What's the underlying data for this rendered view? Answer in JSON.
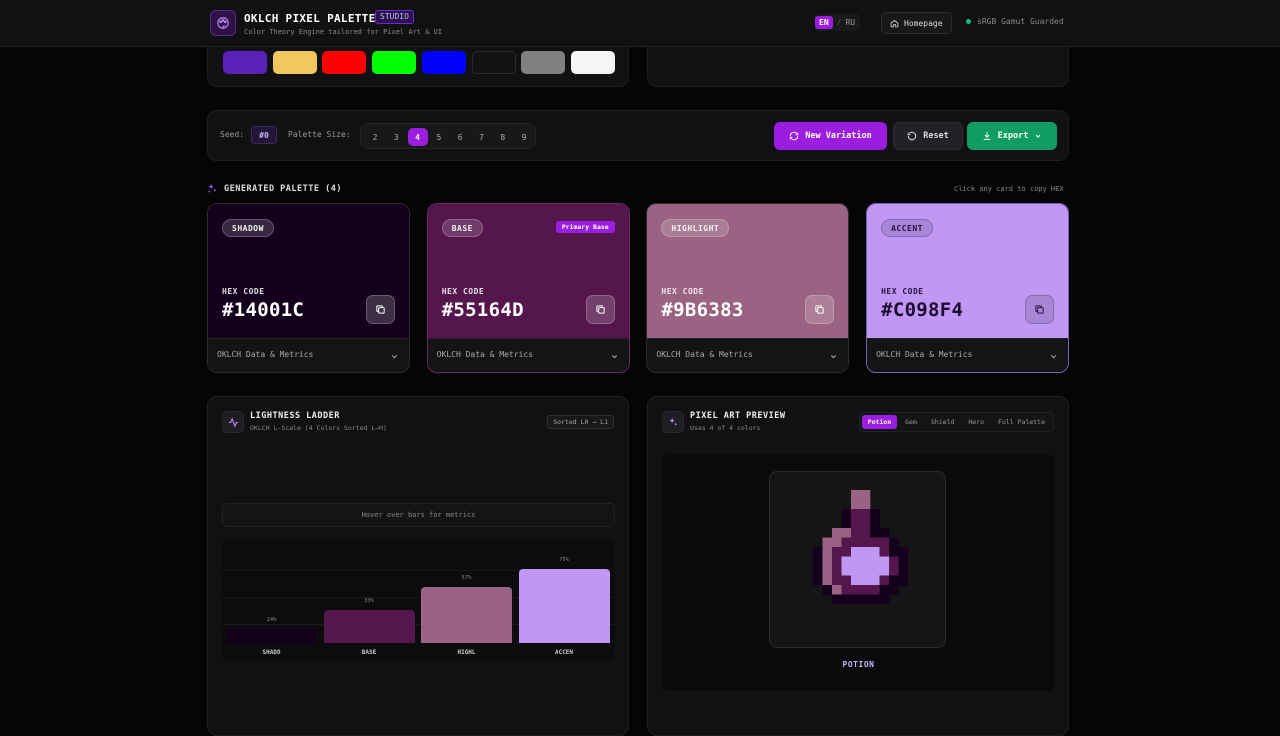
{
  "header": {
    "title": "OKLCH PIXEL PALETTE",
    "badge": "STUDIO",
    "subtitle": "Color Theory Engine tailored for Pixel Art & UI",
    "lang_active": "EN",
    "lang_sep": "/",
    "lang_other": "RU",
    "home_label": "Homepage",
    "gamut_label": "sRGB Gamut Guarded"
  },
  "swatches": [
    "#5b21b6",
    "#f2c75c",
    "#ff0000",
    "#00ff00",
    "#0000ff",
    "#111111",
    "#808080",
    "#f5f5f5"
  ],
  "controls": {
    "seed_label": "Seed:",
    "seed_value": "#0",
    "size_label": "Palette Size:",
    "sizes": [
      "2",
      "3",
      "4",
      "5",
      "6",
      "7",
      "8",
      "9"
    ],
    "selected_size": "4",
    "new_variation": "New Variation",
    "reset": "Reset",
    "export": "Export"
  },
  "palette": {
    "title": "GENERATED PALETTE (4)",
    "hint": "Click any card to copy HEX",
    "hex_label": "HEX CODE",
    "metrics_label": "OKLCH Data & Metrics",
    "primary_badge": "Primary Base",
    "cards": [
      {
        "role": "SHADOW",
        "hex": "#14001C",
        "color": "#14001c"
      },
      {
        "role": "BASE",
        "hex": "#55164D",
        "color": "#55164d"
      },
      {
        "role": "HIGHLIGHT",
        "hex": "#9B6383",
        "color": "#9b6383"
      },
      {
        "role": "ACCENT",
        "hex": "#C098F4",
        "color": "#c098f4"
      }
    ]
  },
  "ladder": {
    "title": "LIGHTNESS LADDER",
    "subtitle": "OKLCH L-Scale (4 Colors Sorted L→H)",
    "badge": "Sorted L0 → L1",
    "hover_hint": "Hover over bars for metrics",
    "bars": [
      {
        "name": "SHADO",
        "pct": "14%",
        "value": 14,
        "color": "#14001c"
      },
      {
        "name": "BASE",
        "pct": "33%",
        "value": 33,
        "color": "#55164d"
      },
      {
        "name": "HIGHL",
        "pct": "57%",
        "value": 57,
        "color": "#9b6383"
      },
      {
        "name": "ACCEN",
        "pct": "75%",
        "value": 75,
        "color": "#c098f4"
      }
    ]
  },
  "preview": {
    "title": "PIXEL ART PREVIEW",
    "subtitle": "Uses 4 of 4 colors",
    "tabs": [
      "Potion",
      "Gem",
      "Shield",
      "Hero",
      "Full Palette"
    ],
    "active_tab": "Potion",
    "caption": "POTION"
  }
}
